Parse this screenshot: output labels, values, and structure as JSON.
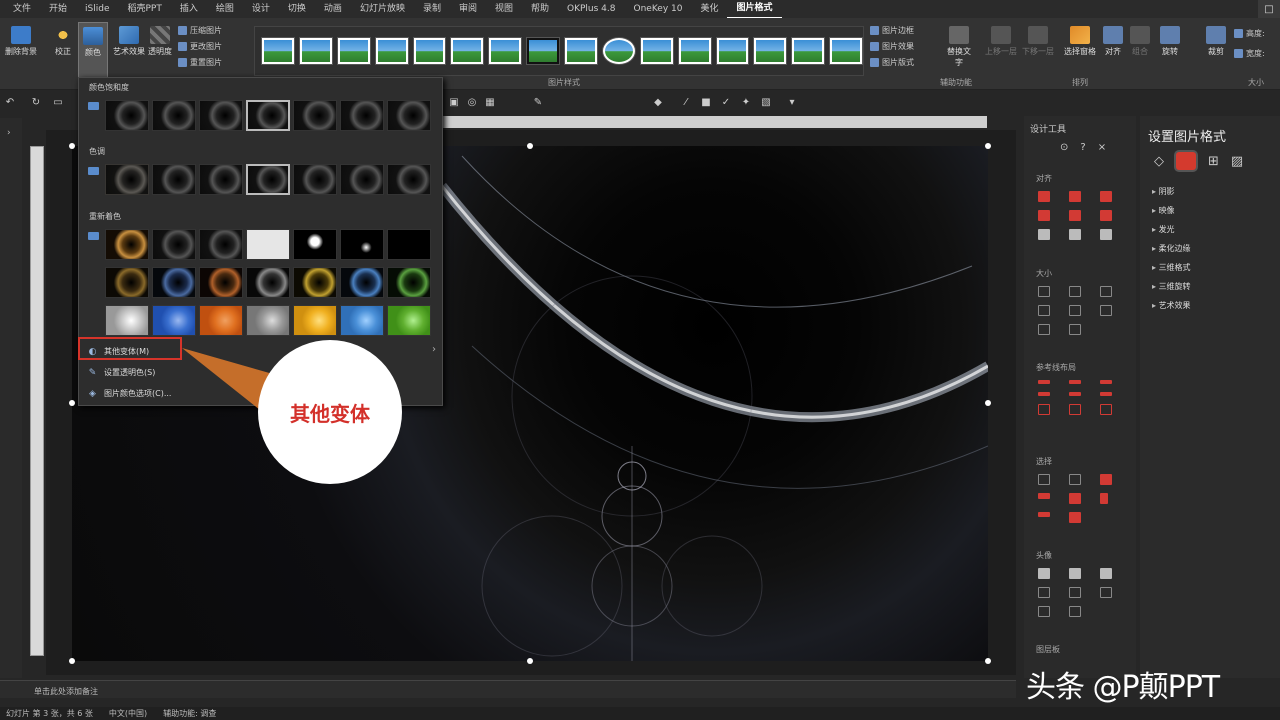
{
  "tabs": [
    "文件",
    "开始",
    "iSlide",
    "稻壳PPT",
    "插入",
    "绘图",
    "设计",
    "切换",
    "动画",
    "幻灯片放映",
    "录制",
    "审阅",
    "视图",
    "帮助",
    "OKPlus 4.8",
    "OneKey 10",
    "美化",
    "图片格式"
  ],
  "active_tab": "图片格式",
  "window": {
    "restore_symbol": "□"
  },
  "ribbon": {
    "remove_bg": "删除背景",
    "corrections": "校正",
    "color": "颜色",
    "artistic_effects": "艺术效果",
    "transparency": "透明度",
    "compress": "压缩图片",
    "change_picture": "更改图片",
    "reset_picture": "重置图片",
    "picture_styles_label": "图片样式",
    "border": "图片边框",
    "effects": "图片效果",
    "layout": "图片版式",
    "accessibility_label": "辅助功能",
    "alt_text": "替换文字",
    "bring_forward": "上移一层",
    "send_backward": "下移一层",
    "selection_pane": "选择窗格",
    "align": "对齐",
    "group": "组合",
    "rotate": "旋转",
    "arrange_label": "排列",
    "crop": "裁剪",
    "height": "高度:",
    "width": "宽度:",
    "size_label": "大小"
  },
  "color_dropdown": {
    "saturation_header": "颜色饱和度",
    "tone_header": "色调",
    "recolor_header": "重新着色",
    "more_variations": "其他变体(M)",
    "set_transparent": "设置透明色(S)",
    "color_options": "图片颜色选项(C)...",
    "submenu_arrow": "›"
  },
  "callout": {
    "text": "其他变体"
  },
  "design_panel": {
    "title": "设计工具",
    "sections": [
      "对齐",
      "大小",
      "参考线布局",
      "选择",
      "头像",
      "图层板"
    ]
  },
  "format_panel": {
    "title": "设置图片格式",
    "items": [
      "阴影",
      "映像",
      "发光",
      "柔化边缘",
      "三维格式",
      "三维旋转",
      "艺术效果"
    ]
  },
  "notes": {
    "placeholder": "单击此处添加备注"
  },
  "status": {
    "slide": "幻灯片 第 3 张，共 6 张",
    "language": "中文(中国)",
    "accessibility": "辅助功能: 调查"
  },
  "watermark": "头条 @P颠PPT"
}
